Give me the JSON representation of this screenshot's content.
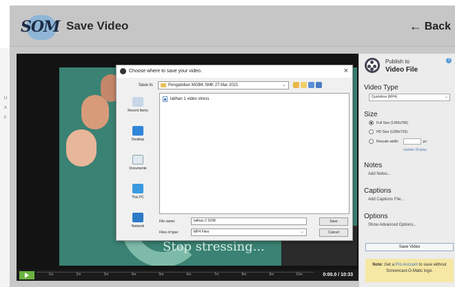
{
  "left_strip": {
    "letters": [
      "U",
      "A",
      "it"
    ]
  },
  "header": {
    "logo_text": "SOM",
    "title": "Save Video",
    "back_label": "Back"
  },
  "video": {
    "caption": "Stop stressing...",
    "timeline_ticks": [
      "1m",
      "2m",
      "3m",
      "4m",
      "5m",
      "6m",
      "7m",
      "8m",
      "9m",
      "10m"
    ],
    "timecode": "0:00.0 / 10:33",
    "playhead_position": 0
  },
  "panel": {
    "publish_small": "Publish to",
    "publish_big": "Video File",
    "help_icon": "?",
    "video_type": {
      "title": "Video Type",
      "selected": "Quicktime (MP4)"
    },
    "size": {
      "title": "Size",
      "options": [
        {
          "label": "Full Size (1366x768)",
          "selected": true
        },
        {
          "label": "HD Size (1280x720)",
          "selected": false
        },
        {
          "label": "Rescale width:",
          "selected": false,
          "unit": "px"
        }
      ],
      "update_link": "Update Display"
    },
    "notes": {
      "title": "Notes",
      "link": "Add Notes..."
    },
    "captions": {
      "title": "Captions",
      "link": "Add Captions File..."
    },
    "options": {
      "title": "Options",
      "link": "Show Advanced Options..."
    },
    "save_button": "Save Video",
    "note": {
      "bold": "Note:",
      "text_before": "Get a",
      "pro_link": "Pro Account",
      "text_after": "to save without Screencast-O-Matic logo."
    }
  },
  "dialog": {
    "title": "Choose where to save your video.",
    "close": "×",
    "save_in_label": "Save in:",
    "save_in_value": "Pengabdian MGBK SMK 27 Mar 2021",
    "places": [
      "Recent Items",
      "Desktop",
      "Documents",
      "This PC",
      "Network"
    ],
    "files": [
      "latihan 1 video stress"
    ],
    "file_name_label": "File name:",
    "file_name_value": "latihan 2 SOM",
    "file_type_label": "Files of type:",
    "file_type_value": "MP4 Files",
    "save_button": "Save",
    "cancel_button": "Cancel"
  },
  "colors": {
    "accent_green": "#6bb23f",
    "link_blue": "#5a7fb2",
    "note_yellow": "#f5e7a4",
    "video_teal": "#3a8273"
  }
}
